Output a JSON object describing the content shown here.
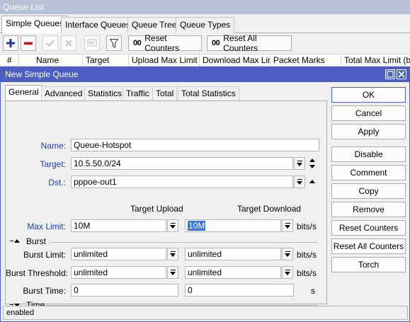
{
  "queue_list": {
    "title": "Queue List",
    "tabs": [
      "Simple Queues",
      "Interface Queues",
      "Queue Tree",
      "Queue Types"
    ],
    "toolbar": {
      "reset_counters_label": "Reset Counters",
      "reset_all_counters_label": "Reset All Counters",
      "counter_icon_text": "00"
    },
    "columns": [
      "#",
      "Name",
      "Target",
      "Upload Max Limit",
      "Download Max Limit",
      "Packet Marks",
      "Total Max Limit (bi..."
    ]
  },
  "dialog": {
    "title": "New Simple Queue",
    "tabs": [
      "General",
      "Advanced",
      "Statistics",
      "Traffic",
      "Total",
      "Total Statistics"
    ],
    "form": {
      "name_label": "Name:",
      "name_value": "Queue-Hotspot",
      "target_label": "Target:",
      "target_value": "10.5.50.0/24",
      "dst_label": "Dst.:",
      "dst_value": "pppoe-out1",
      "col_upload": "Target Upload",
      "col_download": "Target Download",
      "max_limit_label": "Max Limit:",
      "max_limit_upload": "10M",
      "max_limit_download": "10M",
      "burst_section": "Burst",
      "burst_limit_label": "Burst Limit:",
      "burst_limit_upload": "unlimited",
      "burst_limit_download": "unlimited",
      "burst_threshold_label": "Burst Threshold:",
      "burst_threshold_upload": "unlimited",
      "burst_threshold_download": "unlimited",
      "burst_time_label": "Burst Time:",
      "burst_time_upload": "0",
      "burst_time_download": "0",
      "unit_bits": "bits/s",
      "unit_seconds": "s",
      "time_section": "Time"
    },
    "buttons": [
      "OK",
      "Cancel",
      "Apply",
      "Disable",
      "Comment",
      "Copy",
      "Remove",
      "Reset Counters",
      "Reset All Counters",
      "Torch"
    ],
    "status": "enabled"
  },
  "colors": {
    "dialog_title_bg": "#4a5fc1",
    "parent_title_bg": "#b7c1d8",
    "label_blue": "#1f3bb5",
    "selection_bg": "#3875d7",
    "add_icon": "#1c3ea3",
    "remove_icon": "#c01818"
  },
  "icons": [
    "plus-icon",
    "minus-icon",
    "check-icon",
    "cross-icon",
    "comment-icon",
    "filter-icon",
    "maximize-icon",
    "close-icon",
    "dropdown-arrow-icon",
    "up-arrow-icon",
    "down-arrow-icon"
  ]
}
